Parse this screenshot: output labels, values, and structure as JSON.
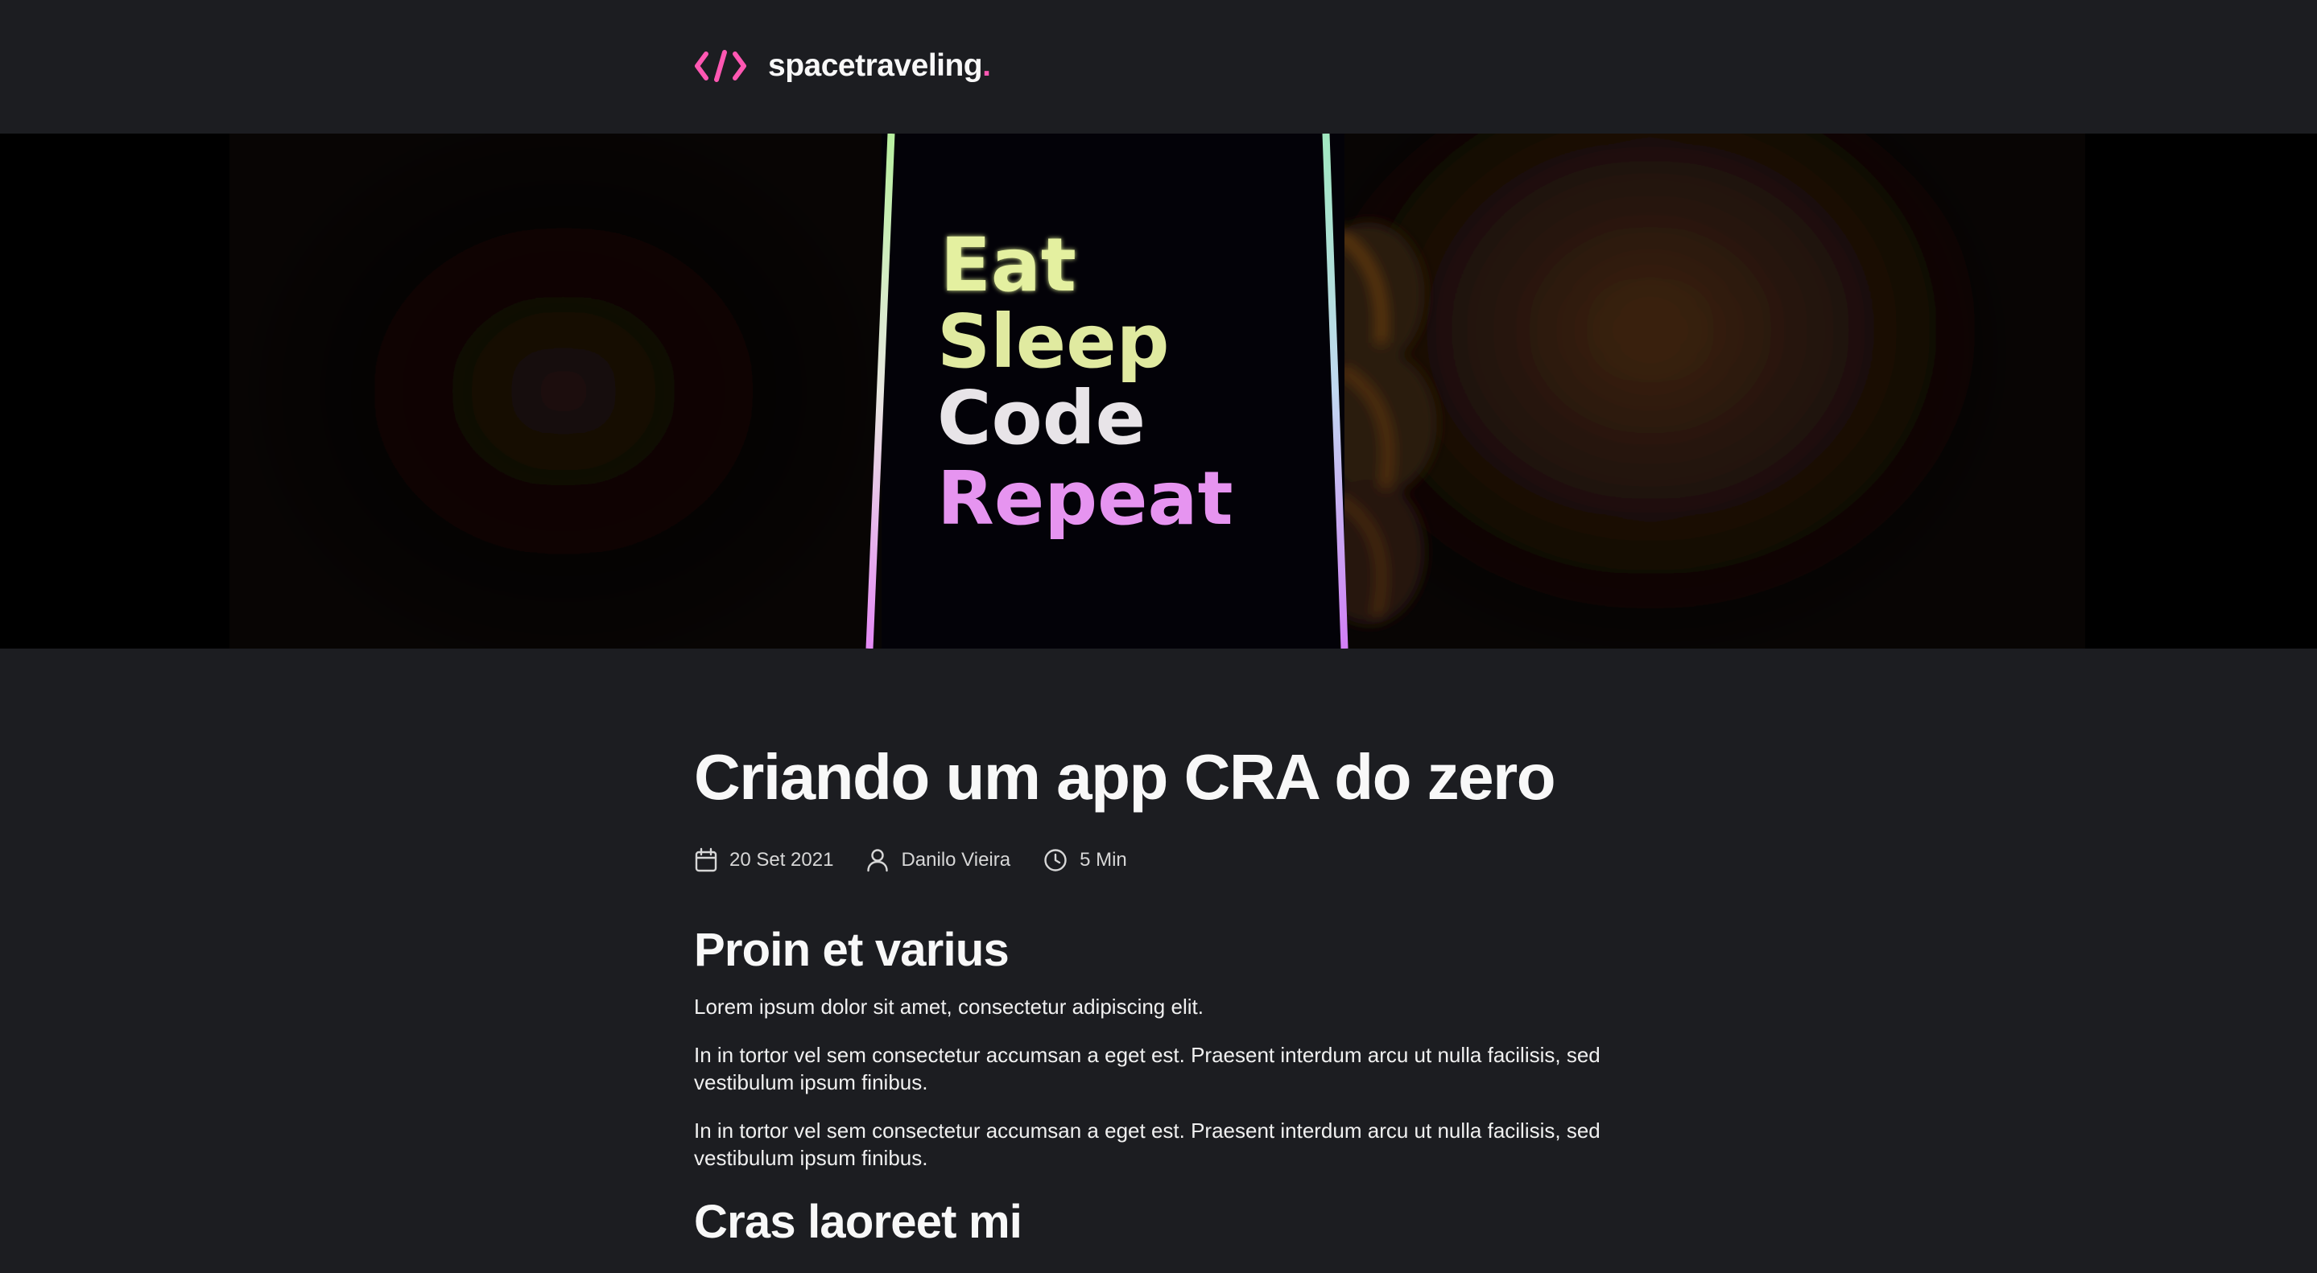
{
  "header": {
    "brand_name": "spacetraveling",
    "brand_dot": ".",
    "brand_icon": "code-brackets-icon"
  },
  "banner": {
    "image_text_lines": [
      "Eat",
      "Sleep",
      "Code",
      "Repeat"
    ]
  },
  "post": {
    "title": "Criando um app CRA do zero",
    "meta": {
      "date": "20 Set 2021",
      "author": "Danilo Vieira",
      "reading_time": "5 Min"
    },
    "sections": [
      {
        "heading": "Proin et varius",
        "paragraphs": [
          "Lorem ipsum dolor sit amet, consectetur adipiscing elit.",
          "In in tortor vel sem consectetur accumsan a eget est. Praesent interdum arcu ut nulla facilisis, sed vestibulum ipsum finibus.",
          "In in tortor vel sem consectetur accumsan a eget est. Praesent interdum arcu ut nulla facilisis, sed vestibulum ipsum finibus."
        ]
      },
      {
        "heading": "Cras laoreet mi"
      }
    ]
  },
  "colors": {
    "background": "#1c1d21",
    "accent": "#ff57b2",
    "heading": "#f8f8f8",
    "text": "#d7d7d7"
  }
}
